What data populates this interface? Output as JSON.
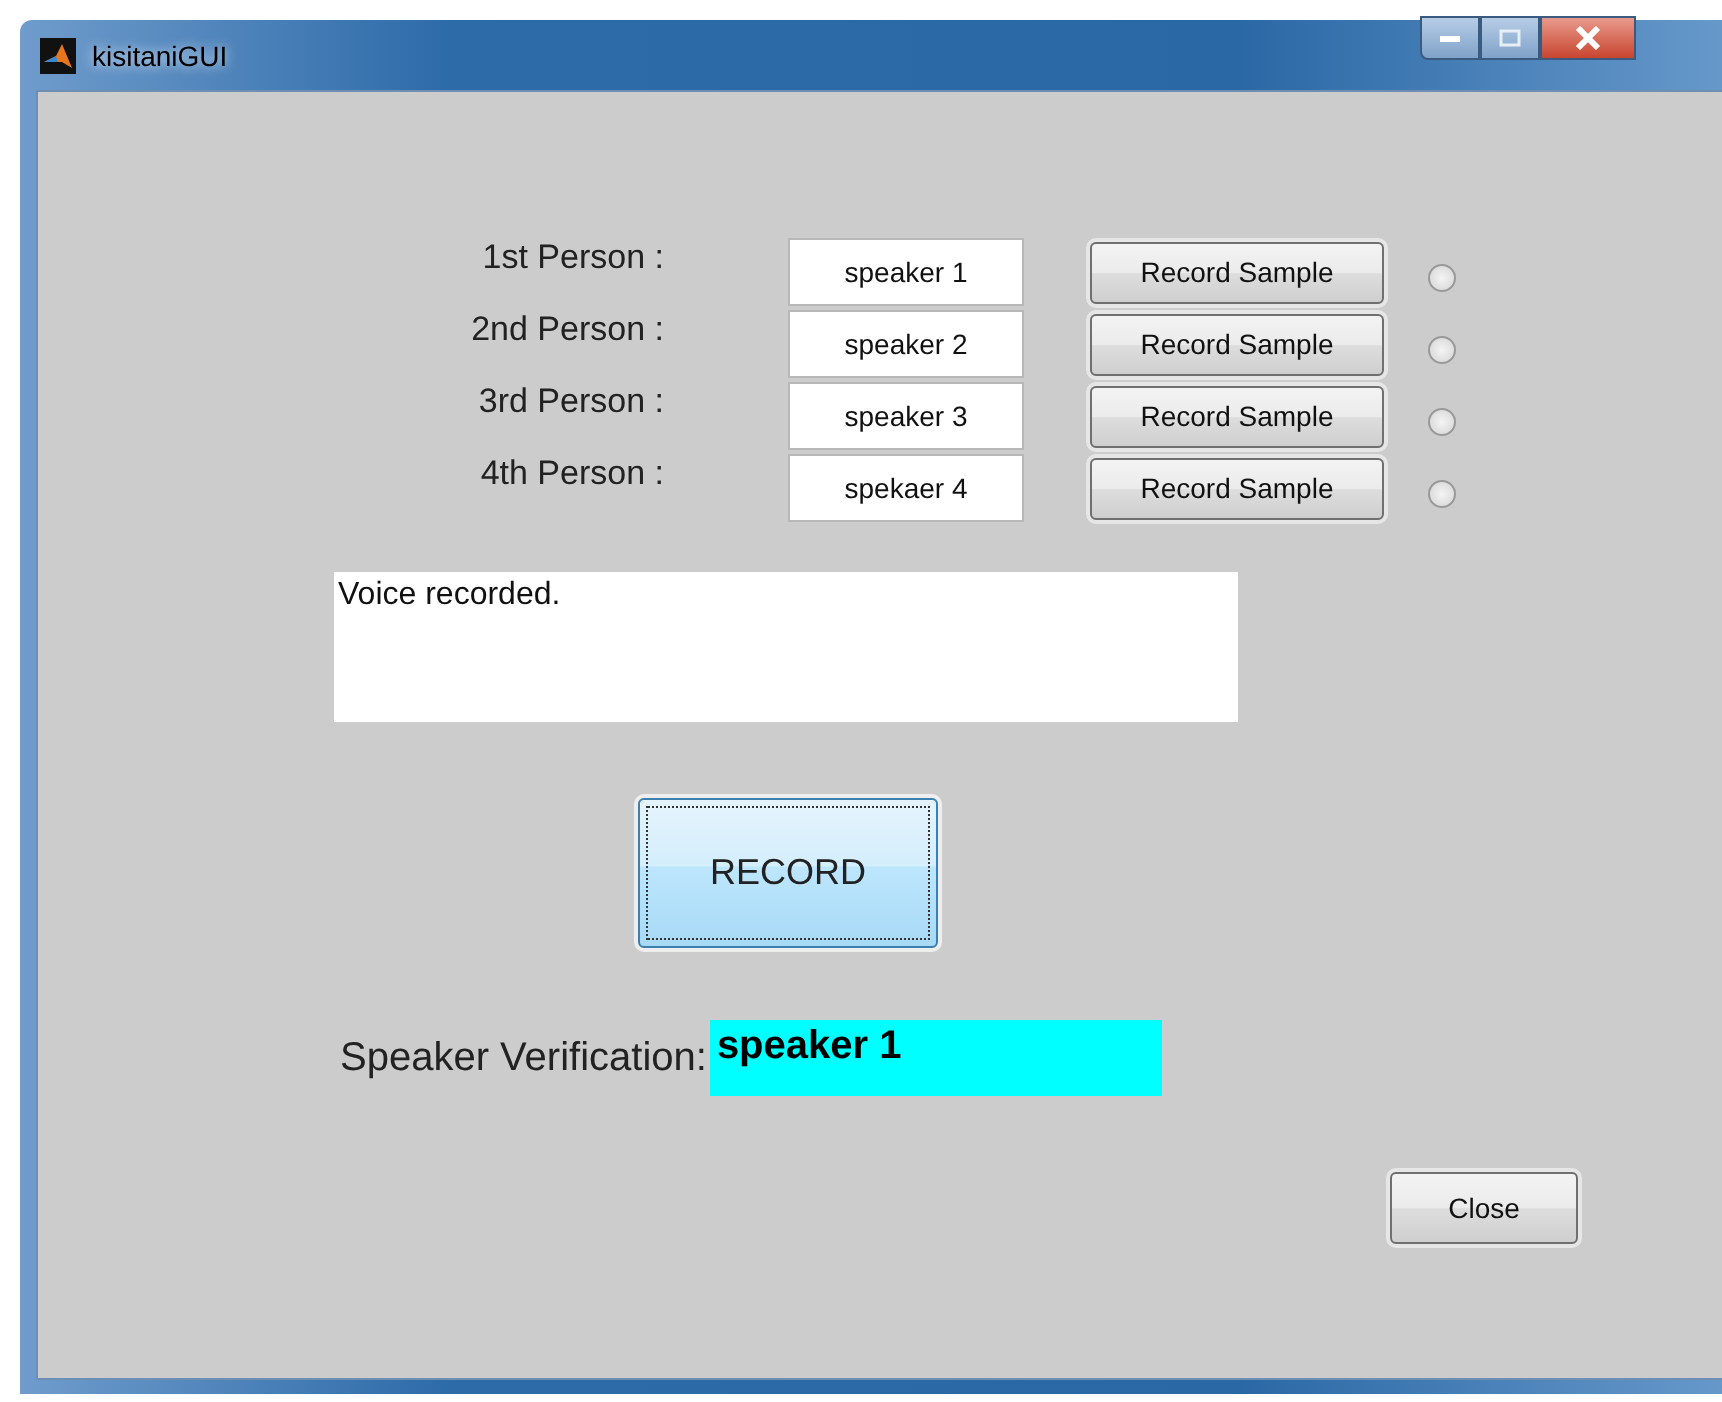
{
  "window": {
    "title": "kisitaniGUI"
  },
  "persons": [
    {
      "label": "1st Person :",
      "name": "speaker 1",
      "button": "Record Sample",
      "selected": false
    },
    {
      "label": "2nd Person :",
      "name": "speaker 2",
      "button": "Record Sample",
      "selected": false
    },
    {
      "label": "3rd Person :",
      "name": "speaker 3",
      "button": "Record Sample",
      "selected": false
    },
    {
      "label": "4th Person :",
      "name": "spekaer 4",
      "button": "Record Sample",
      "selected": false
    }
  ],
  "status_text": "Voice recorded.",
  "record_button": "RECORD",
  "verification": {
    "label": "Speaker Verification:",
    "result": "speaker 1"
  },
  "close_button": "Close"
}
